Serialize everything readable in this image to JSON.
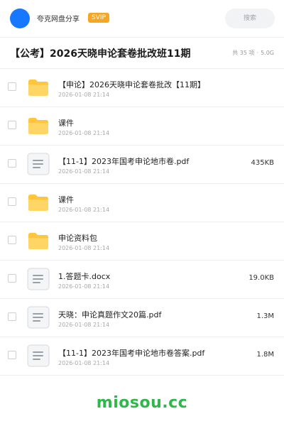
{
  "header": {
    "brand": "夸克网盘分享",
    "badge": "SVIP",
    "search_placeholder": "搜索"
  },
  "folder": {
    "title": "【公考】2026天晓申论套卷批改班11期",
    "count": "共 35 项",
    "separator": "·",
    "total_size": "5.0G"
  },
  "files": [
    {
      "type": "folder",
      "name": "【申论】2026天晓申论套卷批改【11期】",
      "date": "2026-01-08 21:14",
      "size": ""
    },
    {
      "type": "folder",
      "name": "课件",
      "date": "2026-01-08 21:14",
      "size": ""
    },
    {
      "type": "doc",
      "name": "【11-1】2023年国考申论地市卷.pdf",
      "date": "2026-01-08 21:14",
      "size": "435KB"
    },
    {
      "type": "folder",
      "name": "课件",
      "date": "2026-01-08 21:14",
      "size": ""
    },
    {
      "type": "folder",
      "name": "申论资料包",
      "date": "2026-01-08 21:14",
      "size": ""
    },
    {
      "type": "doc",
      "name": "1.答题卡.docx",
      "date": "2026-01-08 21:14",
      "size": "19.0KB"
    },
    {
      "type": "doc",
      "name": "天晓：申论真题作文20篇.pdf",
      "date": "2026-01-08 21:14",
      "size": "1.3M"
    },
    {
      "type": "doc",
      "name": "【11-1】2023年国考申论地市卷答案.pdf",
      "date": "2026-01-08 21:14",
      "size": "1.8M"
    }
  ],
  "watermark": "miosou.cc",
  "colors": {
    "accent": "#1677ff",
    "badge": "#f5a623",
    "folder": "#ffc53d",
    "watermark": "#2fb84a"
  }
}
